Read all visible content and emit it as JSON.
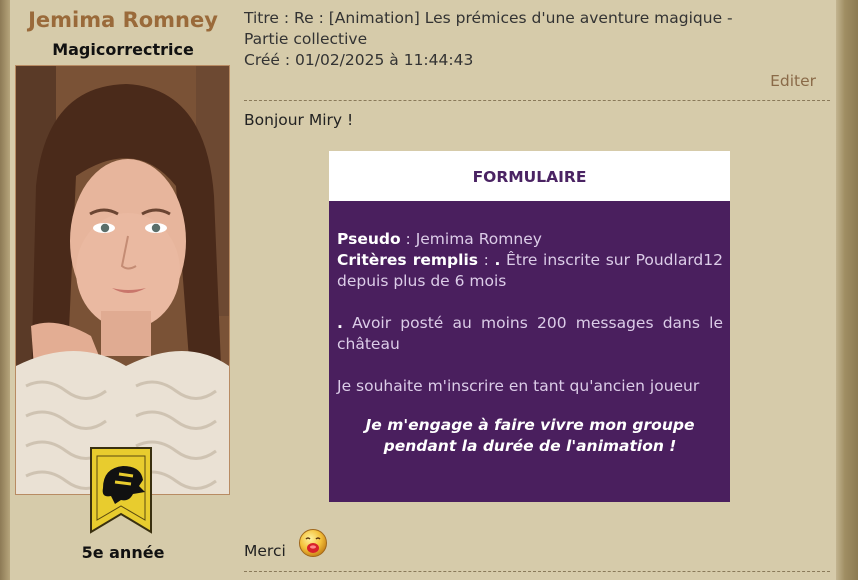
{
  "author": {
    "name": "Jemima Romney",
    "rank": "Magicorrectrice",
    "year": "5e année",
    "badge_icon": "badger-banner-icon"
  },
  "post": {
    "title_label": "Titre : ",
    "title_text": "Re : [Animation] Les prémices d'une aventure magique -",
    "title_text_cont": "Partie collective",
    "created_label": "Créé : ",
    "created_value": "01/02/2025 à 11:44:43",
    "edit_label": "Editer",
    "greeting": "Bonjour Miry !",
    "closing": "Merci",
    "closing_emoji": "kiss-smiley-icon"
  },
  "form": {
    "header": "FORMULAIRE",
    "pseudo_label": "Pseudo",
    "pseudo_value": "Jemima Romney",
    "criteria_label": "Critères remplis",
    "criteria_sep": " : ",
    "criterion1_bullet": ".",
    "criterion1_text": " Être inscrite sur Poudlard12 depuis plus de 6 mois",
    "criterion2_bullet": ".",
    "criterion2_text": " Avoir posté au moins 200 messages dans le château",
    "wish": "Je souhaite m'inscrire en tant qu'ancien joueur",
    "pledge_line1": "Je m'engage à faire vivre mon groupe",
    "pledge_line2": "pendant la durée de l'animation !"
  },
  "colors": {
    "page_bg": "#d6cbaa",
    "author_name": "#9a6a3a",
    "edit_link": "#8a6a48",
    "form_header_text": "#4a2363",
    "form_body_bg": "#4a1f5e",
    "badge_yellow": "#e8cc2e"
  }
}
